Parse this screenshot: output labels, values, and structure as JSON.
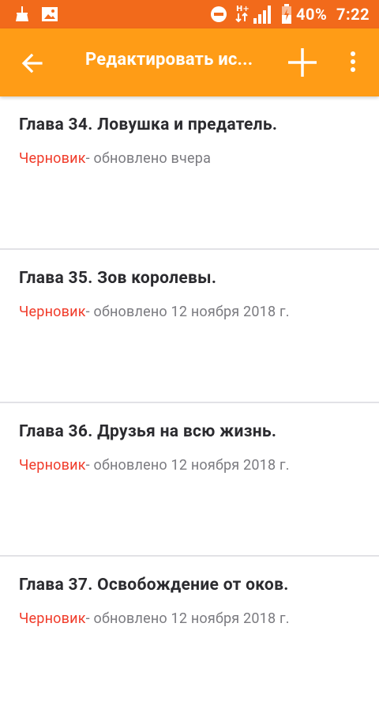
{
  "status_bar": {
    "battery_text": "40%",
    "time": "7:22",
    "network": "H+",
    "icons": [
      "broom-icon",
      "image-icon",
      "do-not-disturb-icon",
      "network-arrows-icon",
      "signal-icon",
      "battery-charging-icon"
    ]
  },
  "toolbar": {
    "title": "Редактировать ис...",
    "icons": [
      "back-arrow-icon",
      "add-icon",
      "more-vert-icon"
    ]
  },
  "chapters": [
    {
      "title": "Глава 34. Ловушка и предатель.",
      "status": "Черновик",
      "updated": "- обновлено вчера"
    },
    {
      "title": "Глава 35. Зов королевы.",
      "status": "Черновик",
      "updated": "- обновлено 12 ноября 2018 г."
    },
    {
      "title": "Глава 36. Друзья на всю жизнь.",
      "status": "Черновик",
      "updated": "- обновлено 12 ноября 2018 г."
    },
    {
      "title": "Глава 37. Освобождение от оков.",
      "status": "Черновик",
      "updated": "- обновлено 12 ноября 2018 г."
    }
  ],
  "colors": {
    "status_bar": "#f26a1b",
    "toolbar": "#ff9c16",
    "draft_red": "#f03b2a",
    "meta_gray": "#7b7b80",
    "title_dark": "#2b2b2f"
  }
}
